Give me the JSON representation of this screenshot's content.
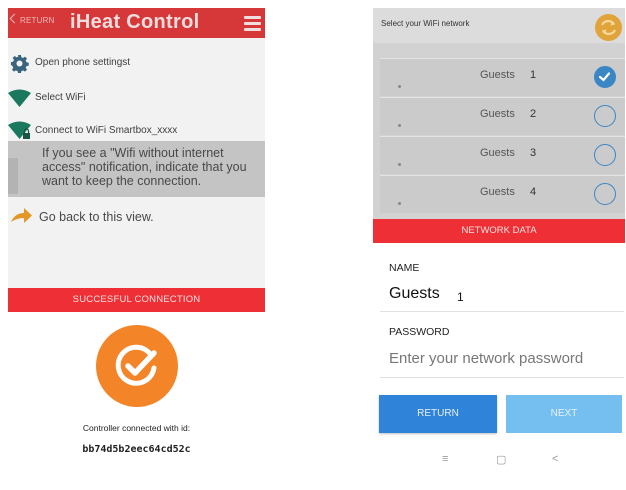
{
  "left": {
    "header": {
      "return_label": "RETURN",
      "title": "iHeat Control"
    },
    "steps": [
      {
        "icon": "gear-icon",
        "label": "Open phone settingst"
      },
      {
        "icon": "wifi-icon",
        "label": "Select WiFi"
      },
      {
        "icon": "wifi-lock-icon",
        "label": "Connect to WiFi Smartbox_xxxx"
      }
    ],
    "note": "If you see a \"Wifi without internet access\" notification, indicate that you want to keep the connection.",
    "go_back": "Go back to this view.",
    "success_banner": "SUCCESFUL CONNECTION",
    "controller_label": "Controller connected with id:",
    "controller_id": "bb74d5b2eec64cd52c"
  },
  "right": {
    "header": {
      "select_label": "Select your WiFi network"
    },
    "networks": [
      {
        "name": "Guests",
        "number": "1",
        "selected": true
      },
      {
        "name": "Guests",
        "number": "2",
        "selected": false
      },
      {
        "name": "Guests",
        "number": "3",
        "selected": false
      },
      {
        "name": "Guests",
        "number": "4",
        "selected": false
      }
    ],
    "network_data_banner": "NETWORK DATA",
    "name_label": "NAME",
    "name_value": "Guests",
    "name_number": "1",
    "password_label": "PASSWORD",
    "password_placeholder": "Enter your network password",
    "return_button": "RETURN",
    "next_button": "NEXT",
    "nav": {
      "menu": "≡",
      "home": "▢",
      "back": "<"
    }
  },
  "colors": {
    "red": "#ef2f36",
    "orange": "#f48428",
    "blue": "#2f83d8",
    "light_blue": "#74bff0",
    "teal": "#1b7f63"
  }
}
